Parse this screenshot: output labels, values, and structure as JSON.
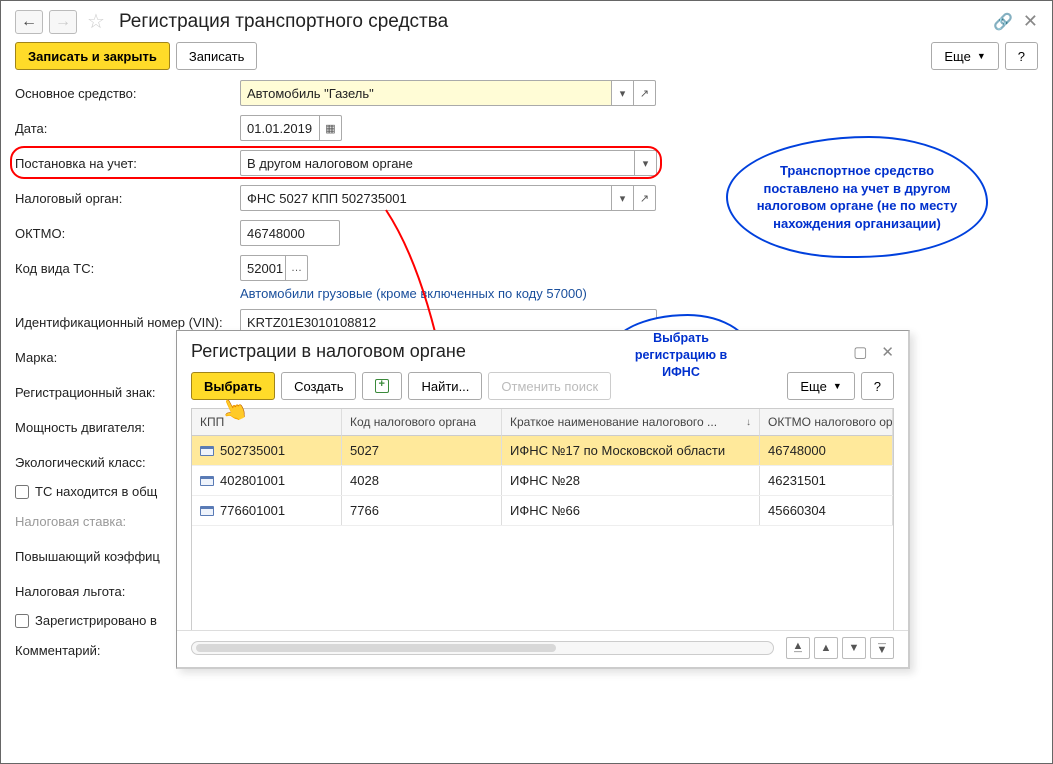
{
  "header": {
    "title": "Регистрация транспортного средства"
  },
  "cmdbar": {
    "save_close": "Записать и закрыть",
    "save": "Записать",
    "more": "Еще",
    "help": "?"
  },
  "form": {
    "asset_label": "Основное средство:",
    "asset_value": "Автомобиль \"Газель\"",
    "date_label": "Дата:",
    "date_value": "01.01.2019",
    "registration_label": "Постановка на учет:",
    "registration_value": "В другом налоговом органе",
    "tax_office_label": "Налоговый орган:",
    "tax_office_value": "ФНС 5027 КПП 502735001",
    "oktmo_label": "ОКТМО:",
    "oktmo_value": "46748000",
    "vehicle_type_label": "Код вида ТС:",
    "vehicle_type_value": "52001",
    "vehicle_type_desc": "Автомобили грузовые (кроме включенных по коду 57000)",
    "vin_label": "Идентификационный номер (VIN):",
    "vin_value": "KRTZ01E3010108812",
    "brand_label": "Марка:",
    "reg_sign_label": "Регистрационный знак:",
    "engine_power_label": "Мощность двигателя:",
    "eco_class_label": "Экологический класс:",
    "shared_ownership_label": "ТС находится в общ",
    "tax_rate_label": "Налоговая ставка:",
    "multiplier_label": "Повышающий коэффиц",
    "tax_benefit_label": "Налоговая льгота:",
    "registered_in_label": "Зарегистрировано в",
    "comment_label": "Комментарий:"
  },
  "dialog": {
    "title": "Регистрации в налоговом органе",
    "select": "Выбрать",
    "create": "Создать",
    "find": "Найти...",
    "cancel_find": "Отменить поиск",
    "more": "Еще",
    "help": "?",
    "columns": {
      "kpp": "КПП",
      "tax_code": "Код налогового органа",
      "short_name": "Краткое наименование налогового ...",
      "oktmo": "ОКТМО налогового орг"
    },
    "rows": [
      {
        "kpp": "502735001",
        "code": "5027",
        "name": "ИФНС №17 по Московской области",
        "oktmo": "46748000"
      },
      {
        "kpp": "402801001",
        "code": "4028",
        "name": "ИФНС №28",
        "oktmo": "46231501"
      },
      {
        "kpp": "776601001",
        "code": "7766",
        "name": "ИФНС №66",
        "oktmo": "45660304"
      }
    ]
  },
  "clouds": {
    "big": "Транспортное средство поставлено на учет в другом налоговом органе (не по месту нахождения организации)",
    "small": "Выбрать регистрацию в ИФНС"
  }
}
